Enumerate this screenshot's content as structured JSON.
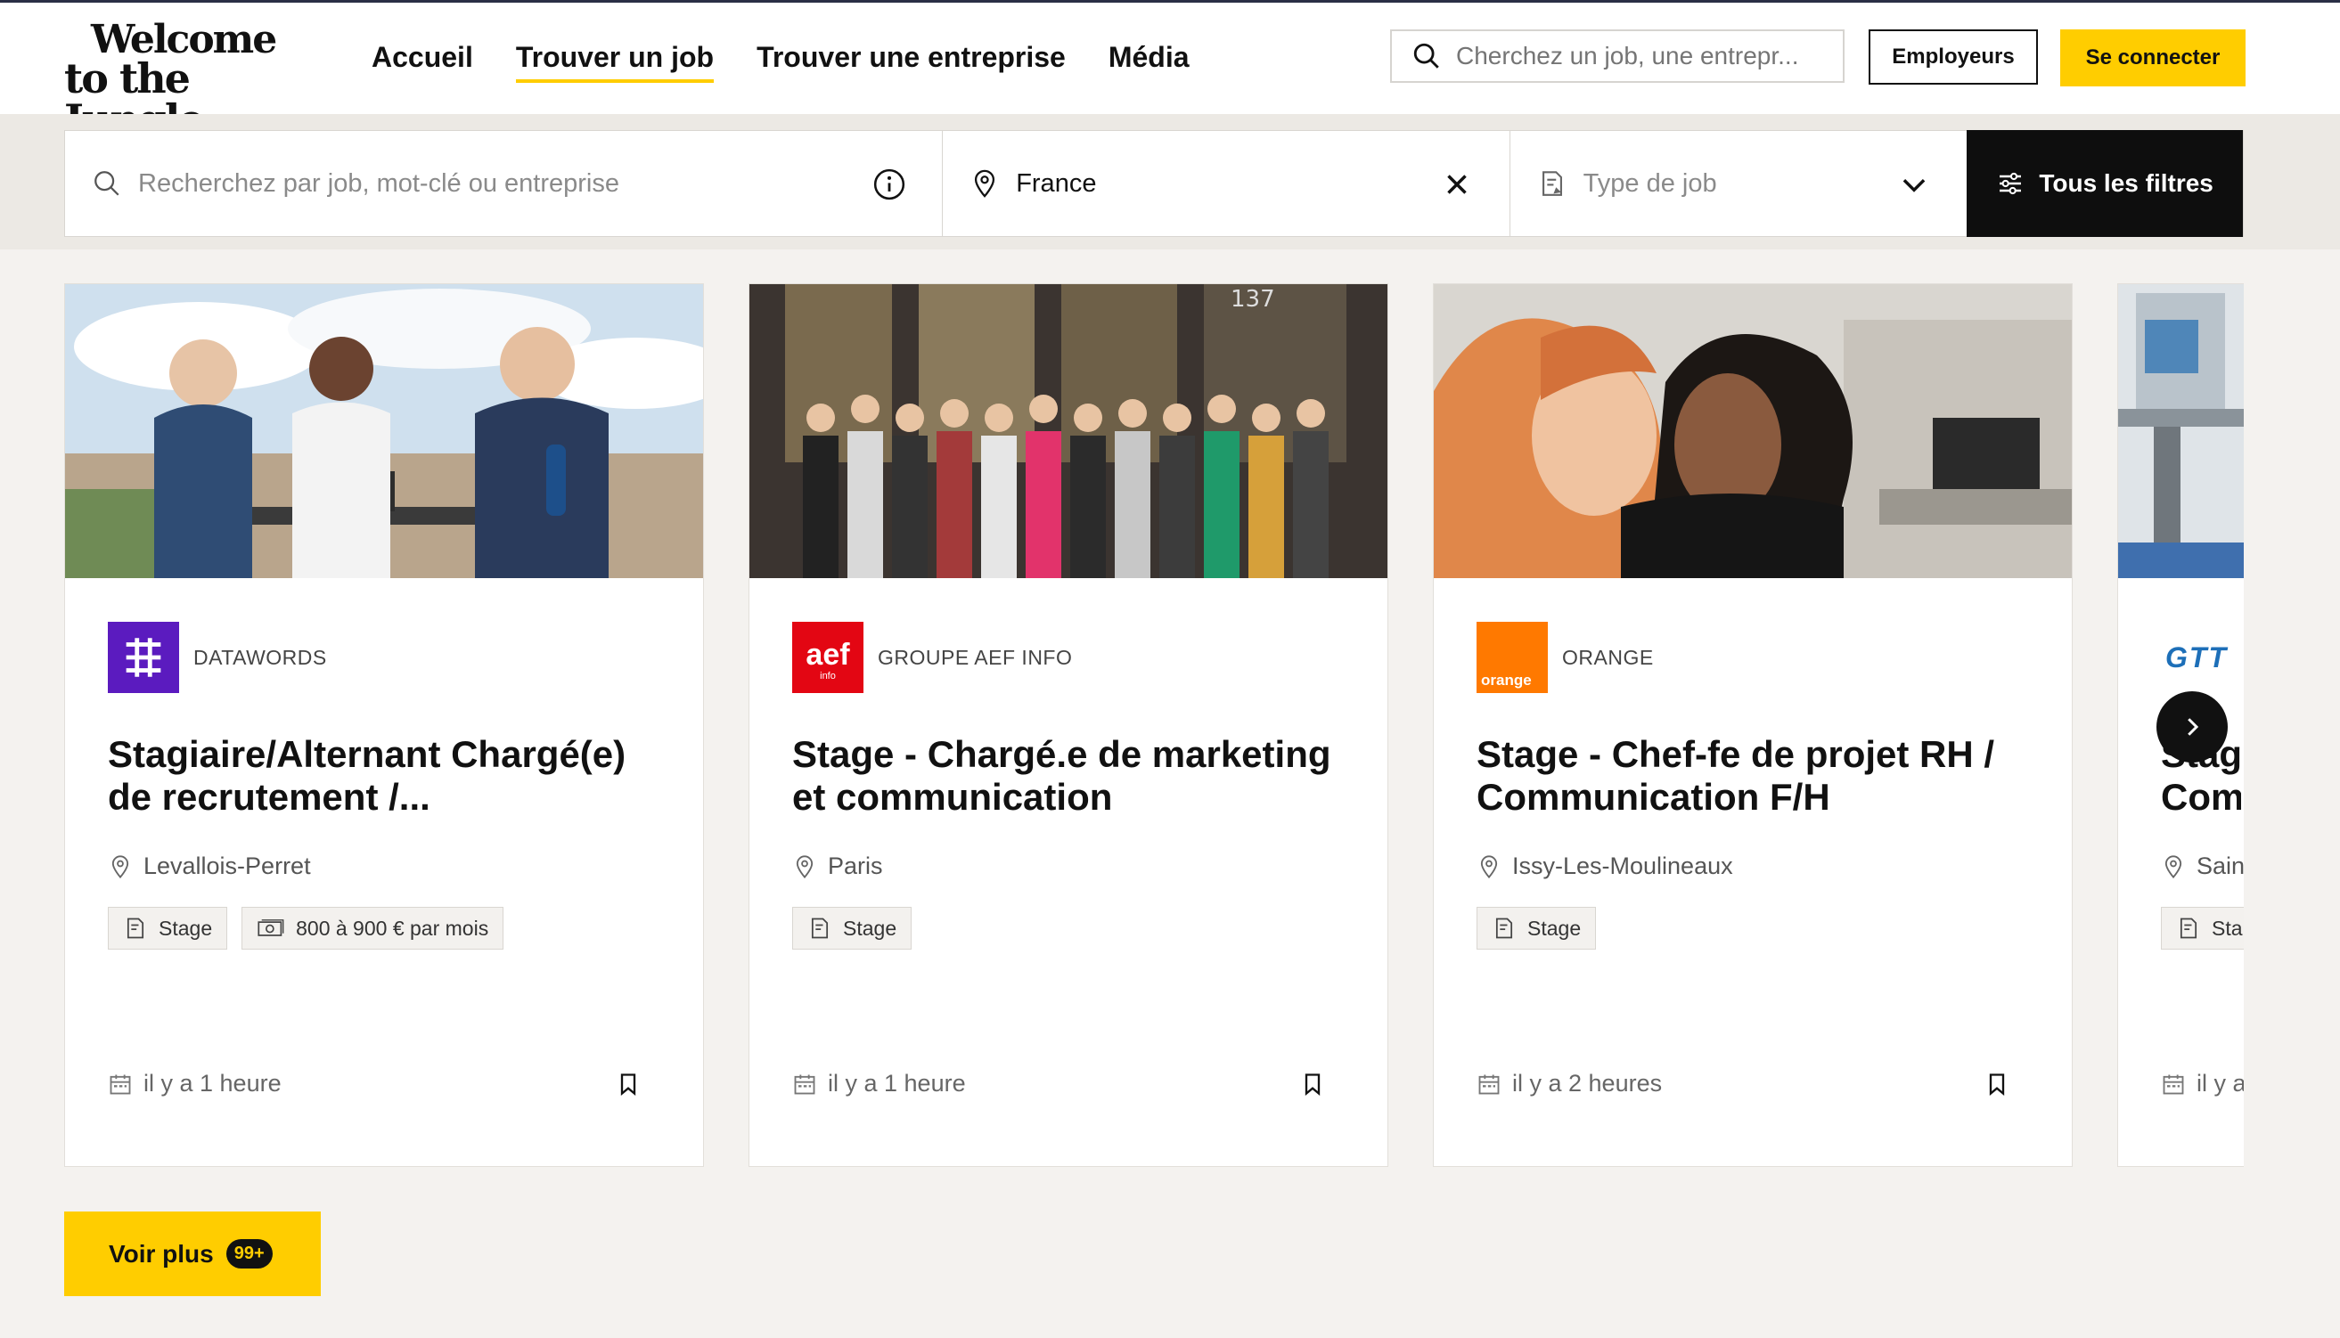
{
  "header": {
    "logo_line1": "Welcome",
    "logo_line2": "to the Jungle",
    "nav": [
      {
        "label": "Accueil"
      },
      {
        "label": "Trouver un job",
        "active": true
      },
      {
        "label": "Trouver une entreprise"
      },
      {
        "label": "Média"
      }
    ],
    "search_placeholder": "Cherchez un job, une entrepr...",
    "employers_label": "Employeurs",
    "connect_label": "Se connecter"
  },
  "filters": {
    "keyword_placeholder": "Recherchez par job, mot-clé ou entreprise",
    "location_value": "France",
    "job_type_placeholder": "Type de job",
    "all_filters_label": "Tous les filtres"
  },
  "jobs": [
    {
      "company": "DATAWORDS",
      "title": "Stagiaire/Alternant Chargé(e) de recrutement /...",
      "location": "Levallois-Perret",
      "tags": [
        "Stage",
        "800 à 900 € par mois"
      ],
      "posted": "il y a 1 heure"
    },
    {
      "company": "GROUPE AEF INFO",
      "title": "Stage - Chargé.e de marketing et communication",
      "location": "Paris",
      "tags": [
        "Stage"
      ],
      "posted": "il y a 1 heure",
      "photo_number": "137"
    },
    {
      "company": "ORANGE",
      "title": "Stage - Chef-fe de projet RH / Communication F/H",
      "location": "Issy-Les-Moulineaux",
      "tags": [
        "Stage"
      ],
      "posted": "il y a 2 heures",
      "logo_text": "orange"
    },
    {
      "company": "",
      "title": "Stag Com",
      "location": "Sain",
      "tags": [
        "Sta"
      ],
      "posted": "il y a",
      "logo_text": "GTT"
    }
  ],
  "more": {
    "label": "Voir plus",
    "badge": "99+"
  },
  "colors": {
    "accent": "#ffcd00",
    "dark": "#0e0e0e",
    "datawords": "#5b1bbf",
    "aef": "#e30613",
    "orange": "#ff7900",
    "gtt": "#1d6fb8"
  }
}
